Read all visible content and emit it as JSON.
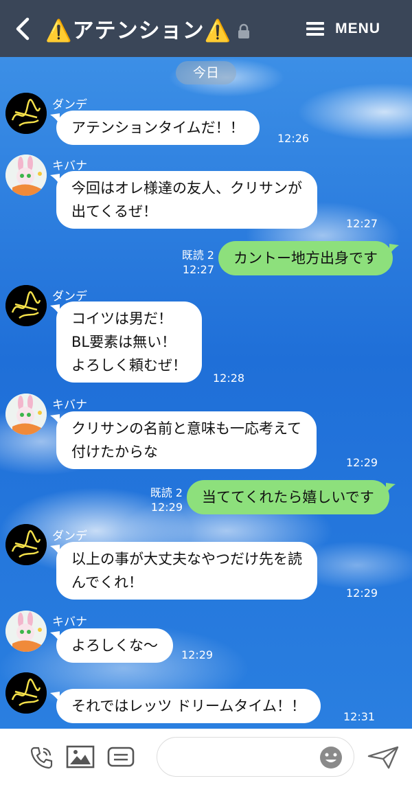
{
  "header": {
    "title": "⚠️アテンション⚠️",
    "menu_label": "MENU"
  },
  "date_label": "今日",
  "messages": [
    {
      "sender": "ダンデ",
      "lines": [
        "アテンションタイムだ！！"
      ],
      "time": "12:26"
    },
    {
      "sender": "キバナ",
      "lines": [
        "今回はオレ様達の友人、クリサンが",
        "出てくるぜ！"
      ],
      "time": "12:27"
    },
    {
      "read": "既読 2",
      "lines": [
        "カントー地方出身です"
      ],
      "time": "12:27"
    },
    {
      "sender": "ダンデ",
      "lines": [
        "コイツは男だ！",
        "BL要素は無い！",
        "よろしく頼むぜ！"
      ],
      "time": "12:28"
    },
    {
      "sender": "キバナ",
      "lines": [
        "クリサンの名前と意味も一応考えて",
        "付けたからな"
      ],
      "time": "12:29"
    },
    {
      "read": "既読 2",
      "lines": [
        "当ててくれたら嬉しいです"
      ],
      "time": "12:29"
    },
    {
      "sender": "ダンデ",
      "lines": [
        "以上の事が大丈夫なやつだけ先を読",
        "んでくれ！"
      ],
      "time": "12:29"
    },
    {
      "sender": "キバナ",
      "lines": [
        "よろしくな〜"
      ],
      "time": "12:29"
    },
    {
      "sender": "",
      "lines": [
        "それではレッツ ドリームタイム！！"
      ],
      "time": "12:31"
    }
  ],
  "icons": {
    "back": "chevron-left-icon",
    "lock": "lock-icon",
    "menu": "hamburger-icon",
    "call": "phone-icon",
    "image": "image-icon",
    "note": "note-icon",
    "emoji": "emoji-icon",
    "send": "send-icon"
  },
  "colors": {
    "header_bg": "#3a4658",
    "bubble_in": "#ffffff",
    "bubble_out": "#8de07c"
  }
}
